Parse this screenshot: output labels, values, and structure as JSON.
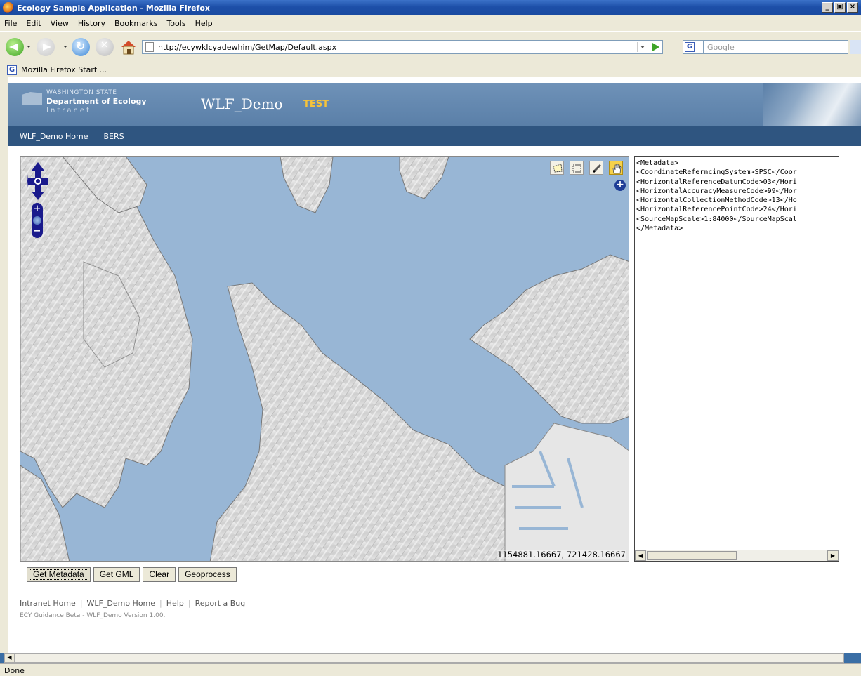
{
  "window": {
    "title": "Ecology Sample Application - Mozilla Firefox",
    "buttons": [
      "_",
      "̈",
      "x"
    ]
  },
  "menu": [
    "File",
    "Edit",
    "View",
    "History",
    "Bookmarks",
    "Tools",
    "Help"
  ],
  "toolbar": {
    "url": "http://ecywklcyadewhim/GetMap/Default.aspx",
    "search_placeholder": "Google",
    "search_engine_icon": "G"
  },
  "bookmarks": {
    "item": "Mozilla Firefox Start ..."
  },
  "header": {
    "state": "WASHINGTON STATE",
    "department": "Department of Ecology",
    "intranet": "Intranet",
    "app_title": "WLF_Demo",
    "environment": "TEST"
  },
  "sitenav": [
    "WLF_Demo Home",
    "BERS"
  ],
  "map": {
    "coordinates": "1154881.16667, 721428.16667",
    "tools": [
      "polygon-tool-icon",
      "rectangle-tool-icon",
      "pencil-tool-icon",
      "pan-hand-icon"
    ],
    "active_tool": "pan-hand-icon",
    "colors": {
      "water": "#98b6d5",
      "land": "#dcdcdc"
    }
  },
  "metadata_lines": [
    "<Metadata>",
    "<CoordinateReferncingSystem>SPSC</Coor",
    "<HorizontalReferenceDatumCode>03</Hori",
    "<HorizontalAccuracyMeasureCode>99</Hor",
    "<HorizontalCollectionMethodCode>13</Ho",
    "<HorizontalReferencePointCode>24</Hori",
    "<SourceMapScale>1:84000</SourceMapScal",
    "</Metadata>"
  ],
  "buttons": {
    "get_metadata": "Get Metadata",
    "get_gml": "Get GML",
    "clear": "Clear",
    "geoprocess": "Geoprocess"
  },
  "footer": {
    "links": [
      "Intranet Home",
      "WLF_Demo Home",
      "Help",
      "Report a Bug"
    ],
    "version": "ECY Guidance Beta - WLF_Demo Version 1.00."
  },
  "status": "Done"
}
